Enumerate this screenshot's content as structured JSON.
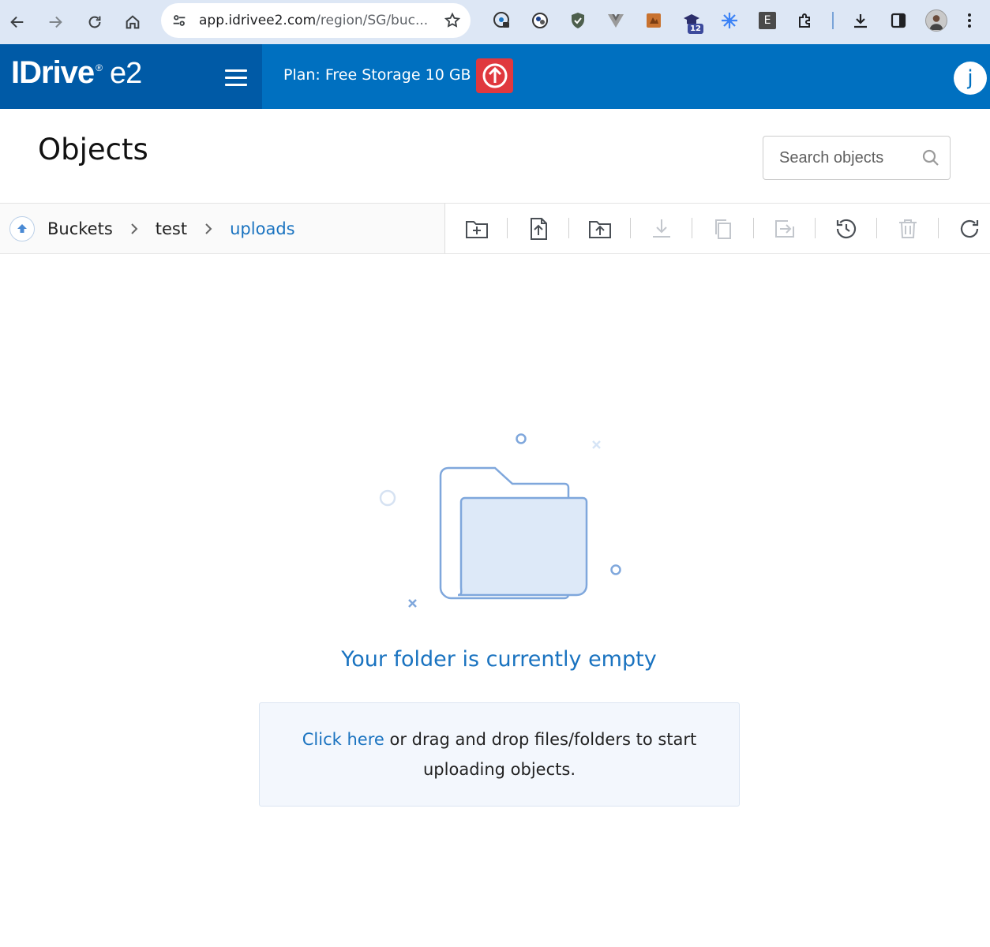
{
  "browser": {
    "url_host": "app.idrivee2.com",
    "url_path": "/region/SG/buc...",
    "extension_badge": "12",
    "extension_e_label": "E"
  },
  "header": {
    "logo_text": "IDrive",
    "logo_reg": "®",
    "logo_product": "e2",
    "plan_label": "Plan: Free Storage 10 GB",
    "user_initial": "j"
  },
  "page": {
    "title": "Objects",
    "search_placeholder": "Search objects"
  },
  "breadcrumb": {
    "items": [
      "Buckets",
      "test",
      "uploads"
    ]
  },
  "toolbar": {
    "actions": [
      {
        "name": "create-folder",
        "icon": "folder-plus-icon",
        "enabled": true
      },
      {
        "name": "upload-file",
        "icon": "file-upload-icon",
        "enabled": true
      },
      {
        "name": "upload-folder",
        "icon": "folder-upload-icon",
        "enabled": true
      },
      {
        "name": "download",
        "icon": "download-icon",
        "enabled": false
      },
      {
        "name": "copy",
        "icon": "copy-icon",
        "enabled": false
      },
      {
        "name": "move",
        "icon": "move-icon",
        "enabled": false
      },
      {
        "name": "version-history",
        "icon": "history-icon",
        "enabled": true
      },
      {
        "name": "delete",
        "icon": "trash-icon",
        "enabled": false
      },
      {
        "name": "refresh",
        "icon": "refresh-icon",
        "enabled": true
      }
    ]
  },
  "empty_state": {
    "title": "Your folder is currently empty",
    "link_text": "Click here",
    "message": " or drag and drop files/folders to start uploading objects."
  },
  "colors": {
    "header_blue": "#0070c0",
    "logo_blue": "#005aa6",
    "accent": "#1a73c0",
    "upgrade_red": "#e0383e"
  }
}
